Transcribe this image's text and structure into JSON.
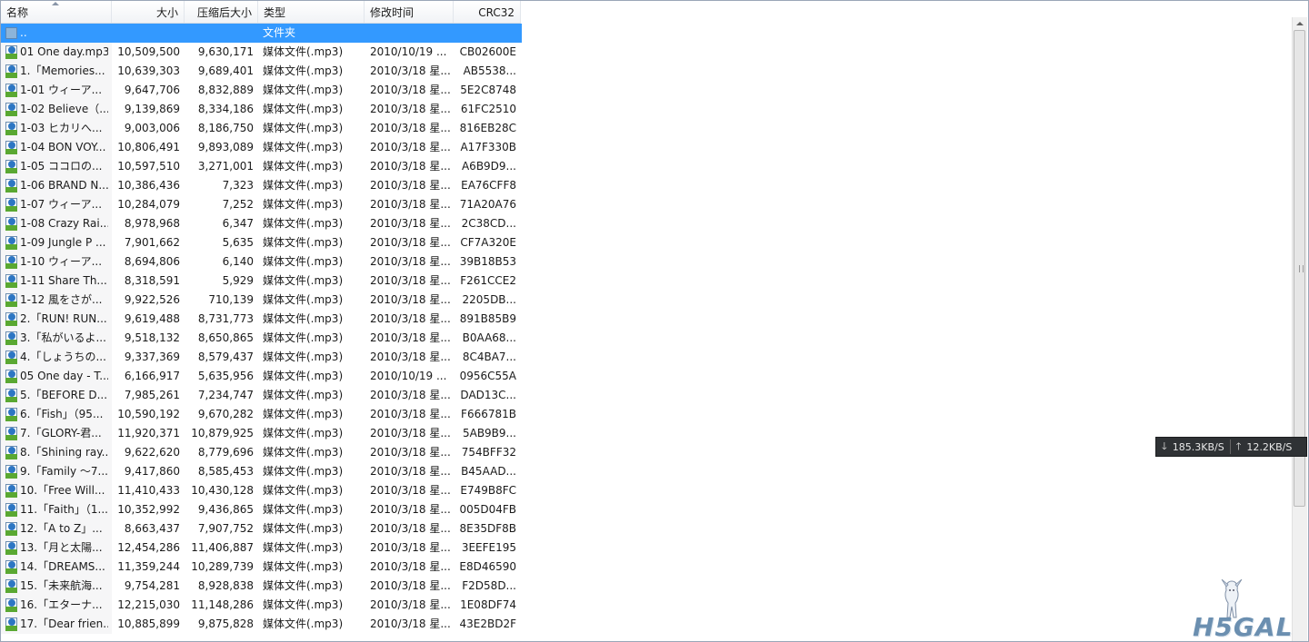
{
  "columns": [
    {
      "key": "name",
      "label": "名称",
      "align": "left",
      "width": 122
    },
    {
      "key": "size",
      "label": "大小",
      "align": "right",
      "width": 80
    },
    {
      "key": "comp",
      "label": "压缩后大小",
      "align": "right",
      "width": 81
    },
    {
      "key": "type",
      "label": "类型",
      "align": "left",
      "width": 117
    },
    {
      "key": "date",
      "label": "修改时间",
      "align": "left",
      "width": 98
    },
    {
      "key": "crc",
      "label": "CRC32",
      "align": "right",
      "width": 74
    }
  ],
  "parent_row": {
    "name": "..",
    "size": "",
    "comp": "",
    "type": "文件夹",
    "date": "",
    "crc": ""
  },
  "rows": [
    {
      "name": "01 One day.mp3",
      "size": "10,509,500",
      "comp": "9,630,171",
      "type": "媒体文件(.mp3)",
      "date": "2010/10/19 ...",
      "crc": "CB02600E"
    },
    {
      "name": "1.「Memories...",
      "size": "10,639,303",
      "comp": "9,689,401",
      "type": "媒体文件(.mp3)",
      "date": "2010/3/18 星...",
      "crc": "AB5538..."
    },
    {
      "name": "1-01 ウィーア...",
      "size": "9,647,706",
      "comp": "8,832,889",
      "type": "媒体文件(.mp3)",
      "date": "2010/3/18 星...",
      "crc": "5E2C8748"
    },
    {
      "name": "1-02 Believe（...",
      "size": "9,139,869",
      "comp": "8,334,186",
      "type": "媒体文件(.mp3)",
      "date": "2010/3/18 星...",
      "crc": "61FC2510"
    },
    {
      "name": "1-03 ヒカリへ...",
      "size": "9,003,006",
      "comp": "8,186,750",
      "type": "媒体文件(.mp3)",
      "date": "2010/3/18 星...",
      "crc": "816EB28C"
    },
    {
      "name": "1-04 BON VOY...",
      "size": "10,806,491",
      "comp": "9,893,089",
      "type": "媒体文件(.mp3)",
      "date": "2010/3/18 星...",
      "crc": "A17F330B"
    },
    {
      "name": "1-05 ココロの...",
      "size": "10,597,510",
      "comp": "3,271,001",
      "type": "媒体文件(.mp3)",
      "date": "2010/3/18 星...",
      "crc": "A6B9D9..."
    },
    {
      "name": "1-06 BRAND N...",
      "size": "10,386,436",
      "comp": "7,323",
      "type": "媒体文件(.mp3)",
      "date": "2010/3/18 星...",
      "crc": "EA76CFF8"
    },
    {
      "name": "1-07 ウィーア...",
      "size": "10,284,079",
      "comp": "7,252",
      "type": "媒体文件(.mp3)",
      "date": "2010/3/18 星...",
      "crc": "71A20A76"
    },
    {
      "name": "1-08 Crazy Rai...",
      "size": "8,978,968",
      "comp": "6,347",
      "type": "媒体文件(.mp3)",
      "date": "2010/3/18 星...",
      "crc": "2C38CD..."
    },
    {
      "name": "1-09 Jungle P ...",
      "size": "7,901,662",
      "comp": "5,635",
      "type": "媒体文件(.mp3)",
      "date": "2010/3/18 星...",
      "crc": "CF7A320E"
    },
    {
      "name": "1-10 ウィーア...",
      "size": "8,694,806",
      "comp": "6,140",
      "type": "媒体文件(.mp3)",
      "date": "2010/3/18 星...",
      "crc": "39B18B53"
    },
    {
      "name": "1-11 Share Th...",
      "size": "8,318,591",
      "comp": "5,929",
      "type": "媒体文件(.mp3)",
      "date": "2010/3/18 星...",
      "crc": "F261CCE2"
    },
    {
      "name": "1-12 風をさが...",
      "size": "9,922,526",
      "comp": "710,139",
      "type": "媒体文件(.mp3)",
      "date": "2010/3/18 星...",
      "crc": "2205DB..."
    },
    {
      "name": "2.「RUN! RUN...",
      "size": "9,619,488",
      "comp": "8,731,773",
      "type": "媒体文件(.mp3)",
      "date": "2010/3/18 星...",
      "crc": "891B85B9"
    },
    {
      "name": "3.「私がいるよ...",
      "size": "9,518,132",
      "comp": "8,650,865",
      "type": "媒体文件(.mp3)",
      "date": "2010/3/18 星...",
      "crc": "B0AA68..."
    },
    {
      "name": "4.「しょうちの...",
      "size": "9,337,369",
      "comp": "8,579,437",
      "type": "媒体文件(.mp3)",
      "date": "2010/3/18 星...",
      "crc": "8C4BA7..."
    },
    {
      "name": "05 One day - T...",
      "size": "6,166,917",
      "comp": "5,635,956",
      "type": "媒体文件(.mp3)",
      "date": "2010/10/19 ...",
      "crc": "0956C55A"
    },
    {
      "name": "5.「BEFORE D...",
      "size": "7,985,261",
      "comp": "7,234,747",
      "type": "媒体文件(.mp3)",
      "date": "2010/3/18 星...",
      "crc": "DAD13C..."
    },
    {
      "name": "6.「Fish」（95...",
      "size": "10,590,192",
      "comp": "9,670,282",
      "type": "媒体文件(.mp3)",
      "date": "2010/3/18 星...",
      "crc": "F666781B"
    },
    {
      "name": "7.「GLORY-君...",
      "size": "11,920,371",
      "comp": "10,879,925",
      "type": "媒体文件(.mp3)",
      "date": "2010/3/18 星...",
      "crc": "5AB9B9..."
    },
    {
      "name": "8.「Shining ray...",
      "size": "9,622,620",
      "comp": "8,779,696",
      "type": "媒体文件(.mp3)",
      "date": "2010/3/18 星...",
      "crc": "754BFF32"
    },
    {
      "name": "9.「Family ～7...",
      "size": "9,417,860",
      "comp": "8,585,453",
      "type": "媒体文件(.mp3)",
      "date": "2010/3/18 星...",
      "crc": "B45AAD..."
    },
    {
      "name": "10.「Free Will...",
      "size": "11,410,433",
      "comp": "10,430,128",
      "type": "媒体文件(.mp3)",
      "date": "2010/3/18 星...",
      "crc": "E749B8FC"
    },
    {
      "name": "11.「Faith」（1...",
      "size": "10,352,992",
      "comp": "9,436,865",
      "type": "媒体文件(.mp3)",
      "date": "2010/3/18 星...",
      "crc": "005D04FB"
    },
    {
      "name": "12.「A to Z」...",
      "size": "8,663,437",
      "comp": "7,907,752",
      "type": "媒体文件(.mp3)",
      "date": "2010/3/18 星...",
      "crc": "8E35DF8B"
    },
    {
      "name": "13.「月と太陽...",
      "size": "12,454,286",
      "comp": "11,406,887",
      "type": "媒体文件(.mp3)",
      "date": "2010/3/18 星...",
      "crc": "3EEFE195"
    },
    {
      "name": "14.「DREAMS...",
      "size": "11,359,244",
      "comp": "10,289,739",
      "type": "媒体文件(.mp3)",
      "date": "2010/3/18 星...",
      "crc": "E8D46590"
    },
    {
      "name": "15.「未来航海...",
      "size": "9,754,281",
      "comp": "8,928,838",
      "type": "媒体文件(.mp3)",
      "date": "2010/3/18 星...",
      "crc": "F2D58D..."
    },
    {
      "name": "16.「エターナ...",
      "size": "12,215,030",
      "comp": "11,148,286",
      "type": "媒体文件(.mp3)",
      "date": "2010/3/18 星...",
      "crc": "1E08DF74"
    },
    {
      "name": "17.「Dear frien...",
      "size": "10,885,899",
      "comp": "9,875,828",
      "type": "媒体文件(.mp3)",
      "date": "2010/3/18 星...",
      "crc": "43E2BD2F"
    }
  ],
  "speed": {
    "down": "185.3KB/S",
    "up": "12.2KB/S",
    "down_arrow": "🡓",
    "up_arrow": "🡑"
  },
  "watermark": {
    "text": "H5GAL"
  },
  "colors": {
    "selection": "#3399ff",
    "header_bg": "#f1f3f6",
    "speed_bg": "#2f3235",
    "mp3_disc": "#2d76c3",
    "mp3_tag": "#5aa832"
  }
}
